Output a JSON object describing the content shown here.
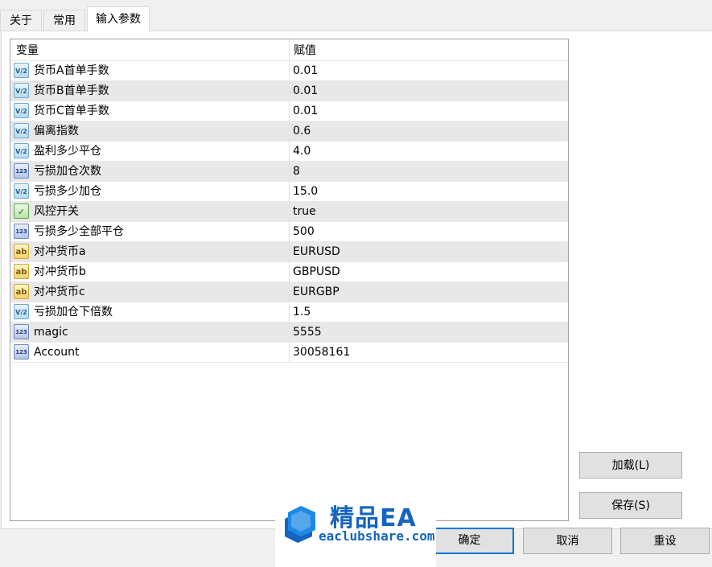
{
  "tabs": [
    {
      "label": "关于",
      "active": false
    },
    {
      "label": "常用",
      "active": false
    },
    {
      "label": "输入参数",
      "active": true
    }
  ],
  "grid": {
    "col_variable": "变量",
    "col_value": "赋值",
    "rows": [
      {
        "icon": "double",
        "icon_text": "V/2",
        "name": "货币A首单手数",
        "value": "0.01"
      },
      {
        "icon": "double",
        "icon_text": "V/2",
        "name": "货币B首单手数",
        "value": "0.01"
      },
      {
        "icon": "double",
        "icon_text": "V/2",
        "name": "货币C首单手数",
        "value": "0.01"
      },
      {
        "icon": "double",
        "icon_text": "V/2",
        "name": "偏离指数",
        "value": "0.6"
      },
      {
        "icon": "double",
        "icon_text": "V/2",
        "name": "盈利多少平仓",
        "value": "4.0"
      },
      {
        "icon": "int",
        "icon_text": "123",
        "name": "亏损加仓次数",
        "value": "8"
      },
      {
        "icon": "double",
        "icon_text": "V/2",
        "name": "亏损多少加仓",
        "value": "15.0"
      },
      {
        "icon": "bool",
        "icon_text": "✓",
        "name": "风控开关",
        "value": "true"
      },
      {
        "icon": "int",
        "icon_text": "123",
        "name": "亏损多少全部平仓",
        "value": "500"
      },
      {
        "icon": "string",
        "icon_text": "ab",
        "name": "对冲货币a",
        "value": "EURUSD"
      },
      {
        "icon": "string",
        "icon_text": "ab",
        "name": "对冲货币b",
        "value": "GBPUSD"
      },
      {
        "icon": "string",
        "icon_text": "ab",
        "name": "对冲货币c",
        "value": "EURGBP"
      },
      {
        "icon": "double",
        "icon_text": "V/2",
        "name": "亏损加仓下倍数",
        "value": "1.5"
      },
      {
        "icon": "int",
        "icon_text": "123",
        "name": "magic",
        "value": "5555"
      },
      {
        "icon": "int",
        "icon_text": "123",
        "name": "Account",
        "value": "30058161"
      }
    ]
  },
  "buttons": {
    "load": "加载(L)",
    "save": "保存(S)",
    "ok": "确定",
    "cancel": "取消",
    "reset": "重设"
  },
  "watermark": {
    "title": "精品EA",
    "site": "eaclubshare.com",
    "color": "#1565c0"
  }
}
